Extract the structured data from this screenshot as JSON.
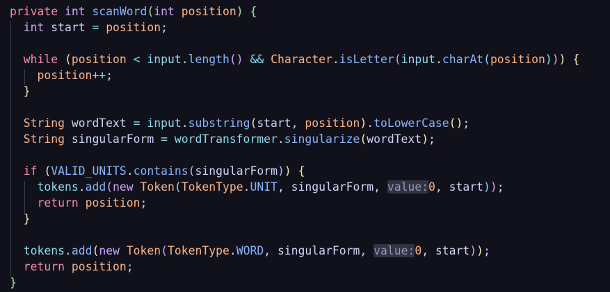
{
  "editor": {
    "colors": {
      "background": "#11111b",
      "keyword": "#cba6f7",
      "function": "#89b4fa",
      "variable": "#fab387",
      "plain": "#cdd6f4",
      "hint_background": "#313244"
    },
    "lines": [
      [
        [
          "kw2",
          "private"
        ],
        [
          "txt",
          " "
        ],
        [
          "kw",
          "int"
        ],
        [
          "txt",
          " "
        ],
        [
          "fn",
          "scanWord"
        ],
        [
          "p4",
          "("
        ],
        [
          "kw",
          "int"
        ],
        [
          "txt",
          " "
        ],
        [
          "var",
          "position"
        ],
        [
          "p4",
          ")"
        ],
        [
          "txt",
          " "
        ],
        [
          "p4",
          "{"
        ]
      ],
      [
        [
          "txt",
          "  "
        ],
        [
          "kw",
          "int"
        ],
        [
          "txt",
          " start "
        ],
        [
          "op",
          "="
        ],
        [
          "txt",
          " "
        ],
        [
          "var",
          "position"
        ],
        [
          "txt",
          ";"
        ]
      ],
      [],
      [
        [
          "txt",
          "  "
        ],
        [
          "kw2",
          "while"
        ],
        [
          "txt",
          " "
        ],
        [
          "p1",
          "("
        ],
        [
          "var",
          "position"
        ],
        [
          "txt",
          " "
        ],
        [
          "op",
          "<"
        ],
        [
          "txt",
          " "
        ],
        [
          "fld",
          "input"
        ],
        [
          "txt",
          "."
        ],
        [
          "fn",
          "length"
        ],
        [
          "p2",
          "()"
        ],
        [
          "txt",
          " "
        ],
        [
          "op",
          "&&"
        ],
        [
          "txt",
          " "
        ],
        [
          "ty",
          "Character"
        ],
        [
          "txt",
          "."
        ],
        [
          "fn",
          "isLetter"
        ],
        [
          "p2",
          "("
        ],
        [
          "fld",
          "input"
        ],
        [
          "txt",
          "."
        ],
        [
          "fn",
          "charAt"
        ],
        [
          "p3",
          "("
        ],
        [
          "var",
          "position"
        ],
        [
          "p3",
          ")"
        ],
        [
          "p2",
          ")"
        ],
        [
          "p1",
          ")"
        ],
        [
          "txt",
          " "
        ],
        [
          "p1",
          "{"
        ]
      ],
      [
        [
          "txt",
          "    "
        ],
        [
          "var",
          "position"
        ],
        [
          "op",
          "++"
        ],
        [
          "txt",
          ";"
        ]
      ],
      [
        [
          "txt",
          "  "
        ],
        [
          "p1",
          "}"
        ]
      ],
      [],
      [
        [
          "txt",
          "  "
        ],
        [
          "ty",
          "String"
        ],
        [
          "txt",
          " wordText "
        ],
        [
          "op",
          "="
        ],
        [
          "txt",
          " "
        ],
        [
          "fld",
          "input"
        ],
        [
          "txt",
          "."
        ],
        [
          "fn",
          "substring"
        ],
        [
          "p1",
          "("
        ],
        [
          "txt",
          "start, "
        ],
        [
          "var",
          "position"
        ],
        [
          "p1",
          ")"
        ],
        [
          "txt",
          "."
        ],
        [
          "fn",
          "toLowerCase"
        ],
        [
          "p1",
          "()"
        ],
        [
          "txt",
          ";"
        ]
      ],
      [
        [
          "txt",
          "  "
        ],
        [
          "ty",
          "String"
        ],
        [
          "txt",
          " singularForm "
        ],
        [
          "op",
          "="
        ],
        [
          "txt",
          " "
        ],
        [
          "fld",
          "wordTransformer"
        ],
        [
          "txt",
          "."
        ],
        [
          "fn",
          "singularize"
        ],
        [
          "p1",
          "("
        ],
        [
          "txt",
          "wordText"
        ],
        [
          "p1",
          ")"
        ],
        [
          "txt",
          ";"
        ]
      ],
      [],
      [
        [
          "txt",
          "  "
        ],
        [
          "kw2",
          "if"
        ],
        [
          "txt",
          " "
        ],
        [
          "p1",
          "("
        ],
        [
          "cst",
          "VALID_UNITS"
        ],
        [
          "txt",
          "."
        ],
        [
          "fn",
          "contains"
        ],
        [
          "p2",
          "("
        ],
        [
          "txt",
          "singularForm"
        ],
        [
          "p2",
          ")"
        ],
        [
          "p1",
          ")"
        ],
        [
          "txt",
          " "
        ],
        [
          "p1",
          "{"
        ]
      ],
      [
        [
          "txt",
          "    "
        ],
        [
          "fld",
          "tokens"
        ],
        [
          "txt",
          "."
        ],
        [
          "fn",
          "add"
        ],
        [
          "p2",
          "("
        ],
        [
          "kw",
          "new"
        ],
        [
          "txt",
          " "
        ],
        [
          "ty",
          "Token"
        ],
        [
          "p3",
          "("
        ],
        [
          "ty",
          "TokenType"
        ],
        [
          "txt",
          "."
        ],
        [
          "cst",
          "UNIT"
        ],
        [
          "txt",
          ", singularForm, "
        ],
        [
          "hint",
          "value:"
        ],
        [
          "num",
          "0"
        ],
        [
          "txt",
          ", start"
        ],
        [
          "p3",
          ")"
        ],
        [
          "p2",
          ")"
        ],
        [
          "txt",
          ";"
        ]
      ],
      [
        [
          "txt",
          "    "
        ],
        [
          "kw2",
          "return"
        ],
        [
          "txt",
          " "
        ],
        [
          "var",
          "position"
        ],
        [
          "txt",
          ";"
        ]
      ],
      [
        [
          "txt",
          "  "
        ],
        [
          "p1",
          "}"
        ]
      ],
      [],
      [
        [
          "txt",
          "  "
        ],
        [
          "fld",
          "tokens"
        ],
        [
          "txt",
          "."
        ],
        [
          "fn",
          "add"
        ],
        [
          "p1",
          "("
        ],
        [
          "kw",
          "new"
        ],
        [
          "txt",
          " "
        ],
        [
          "ty",
          "Token"
        ],
        [
          "p2",
          "("
        ],
        [
          "ty",
          "TokenType"
        ],
        [
          "txt",
          "."
        ],
        [
          "cst",
          "WORD"
        ],
        [
          "txt",
          ", singularForm, "
        ],
        [
          "hint",
          "value:"
        ],
        [
          "num",
          "0"
        ],
        [
          "txt",
          ", start"
        ],
        [
          "p2",
          ")"
        ],
        [
          "p1",
          ")"
        ],
        [
          "txt",
          ";"
        ]
      ],
      [
        [
          "txt",
          "  "
        ],
        [
          "kw2",
          "return"
        ],
        [
          "txt",
          " "
        ],
        [
          "var",
          "position"
        ],
        [
          "txt",
          ";"
        ]
      ],
      [
        [
          "p4",
          "}"
        ]
      ]
    ]
  }
}
